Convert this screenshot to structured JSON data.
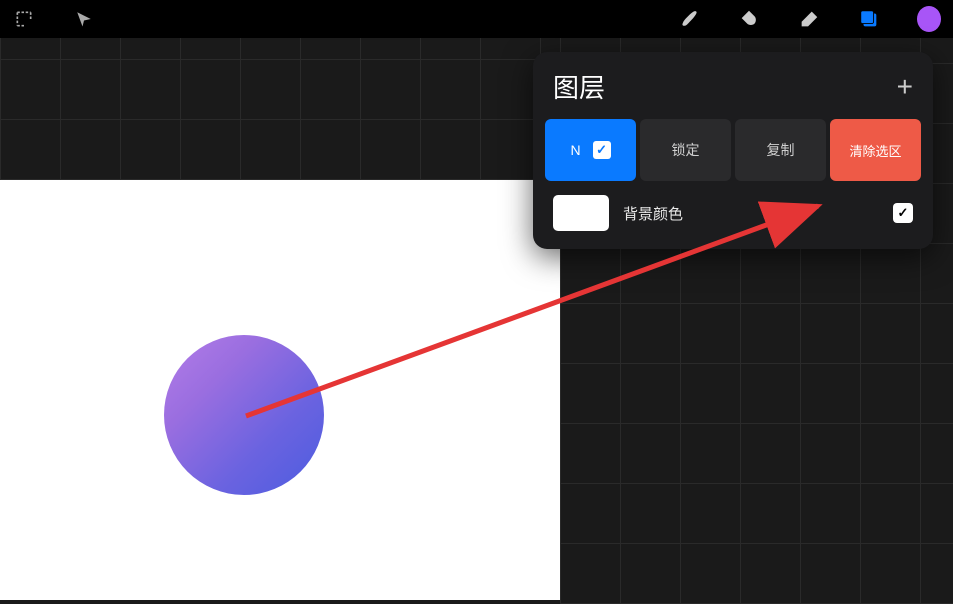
{
  "layers_panel": {
    "title": "图层",
    "layer_actions": {
      "blend_mode": "N",
      "lock": "锁定",
      "duplicate": "复制",
      "clear_selection": "清除选区"
    },
    "background": {
      "label": "背景颜色",
      "visible": true
    }
  },
  "toolbar": {
    "active_color": "#a855f7"
  },
  "canvas": {
    "circle_gradient_start": "#b47de8",
    "circle_gradient_end": "#4b5ce0"
  }
}
